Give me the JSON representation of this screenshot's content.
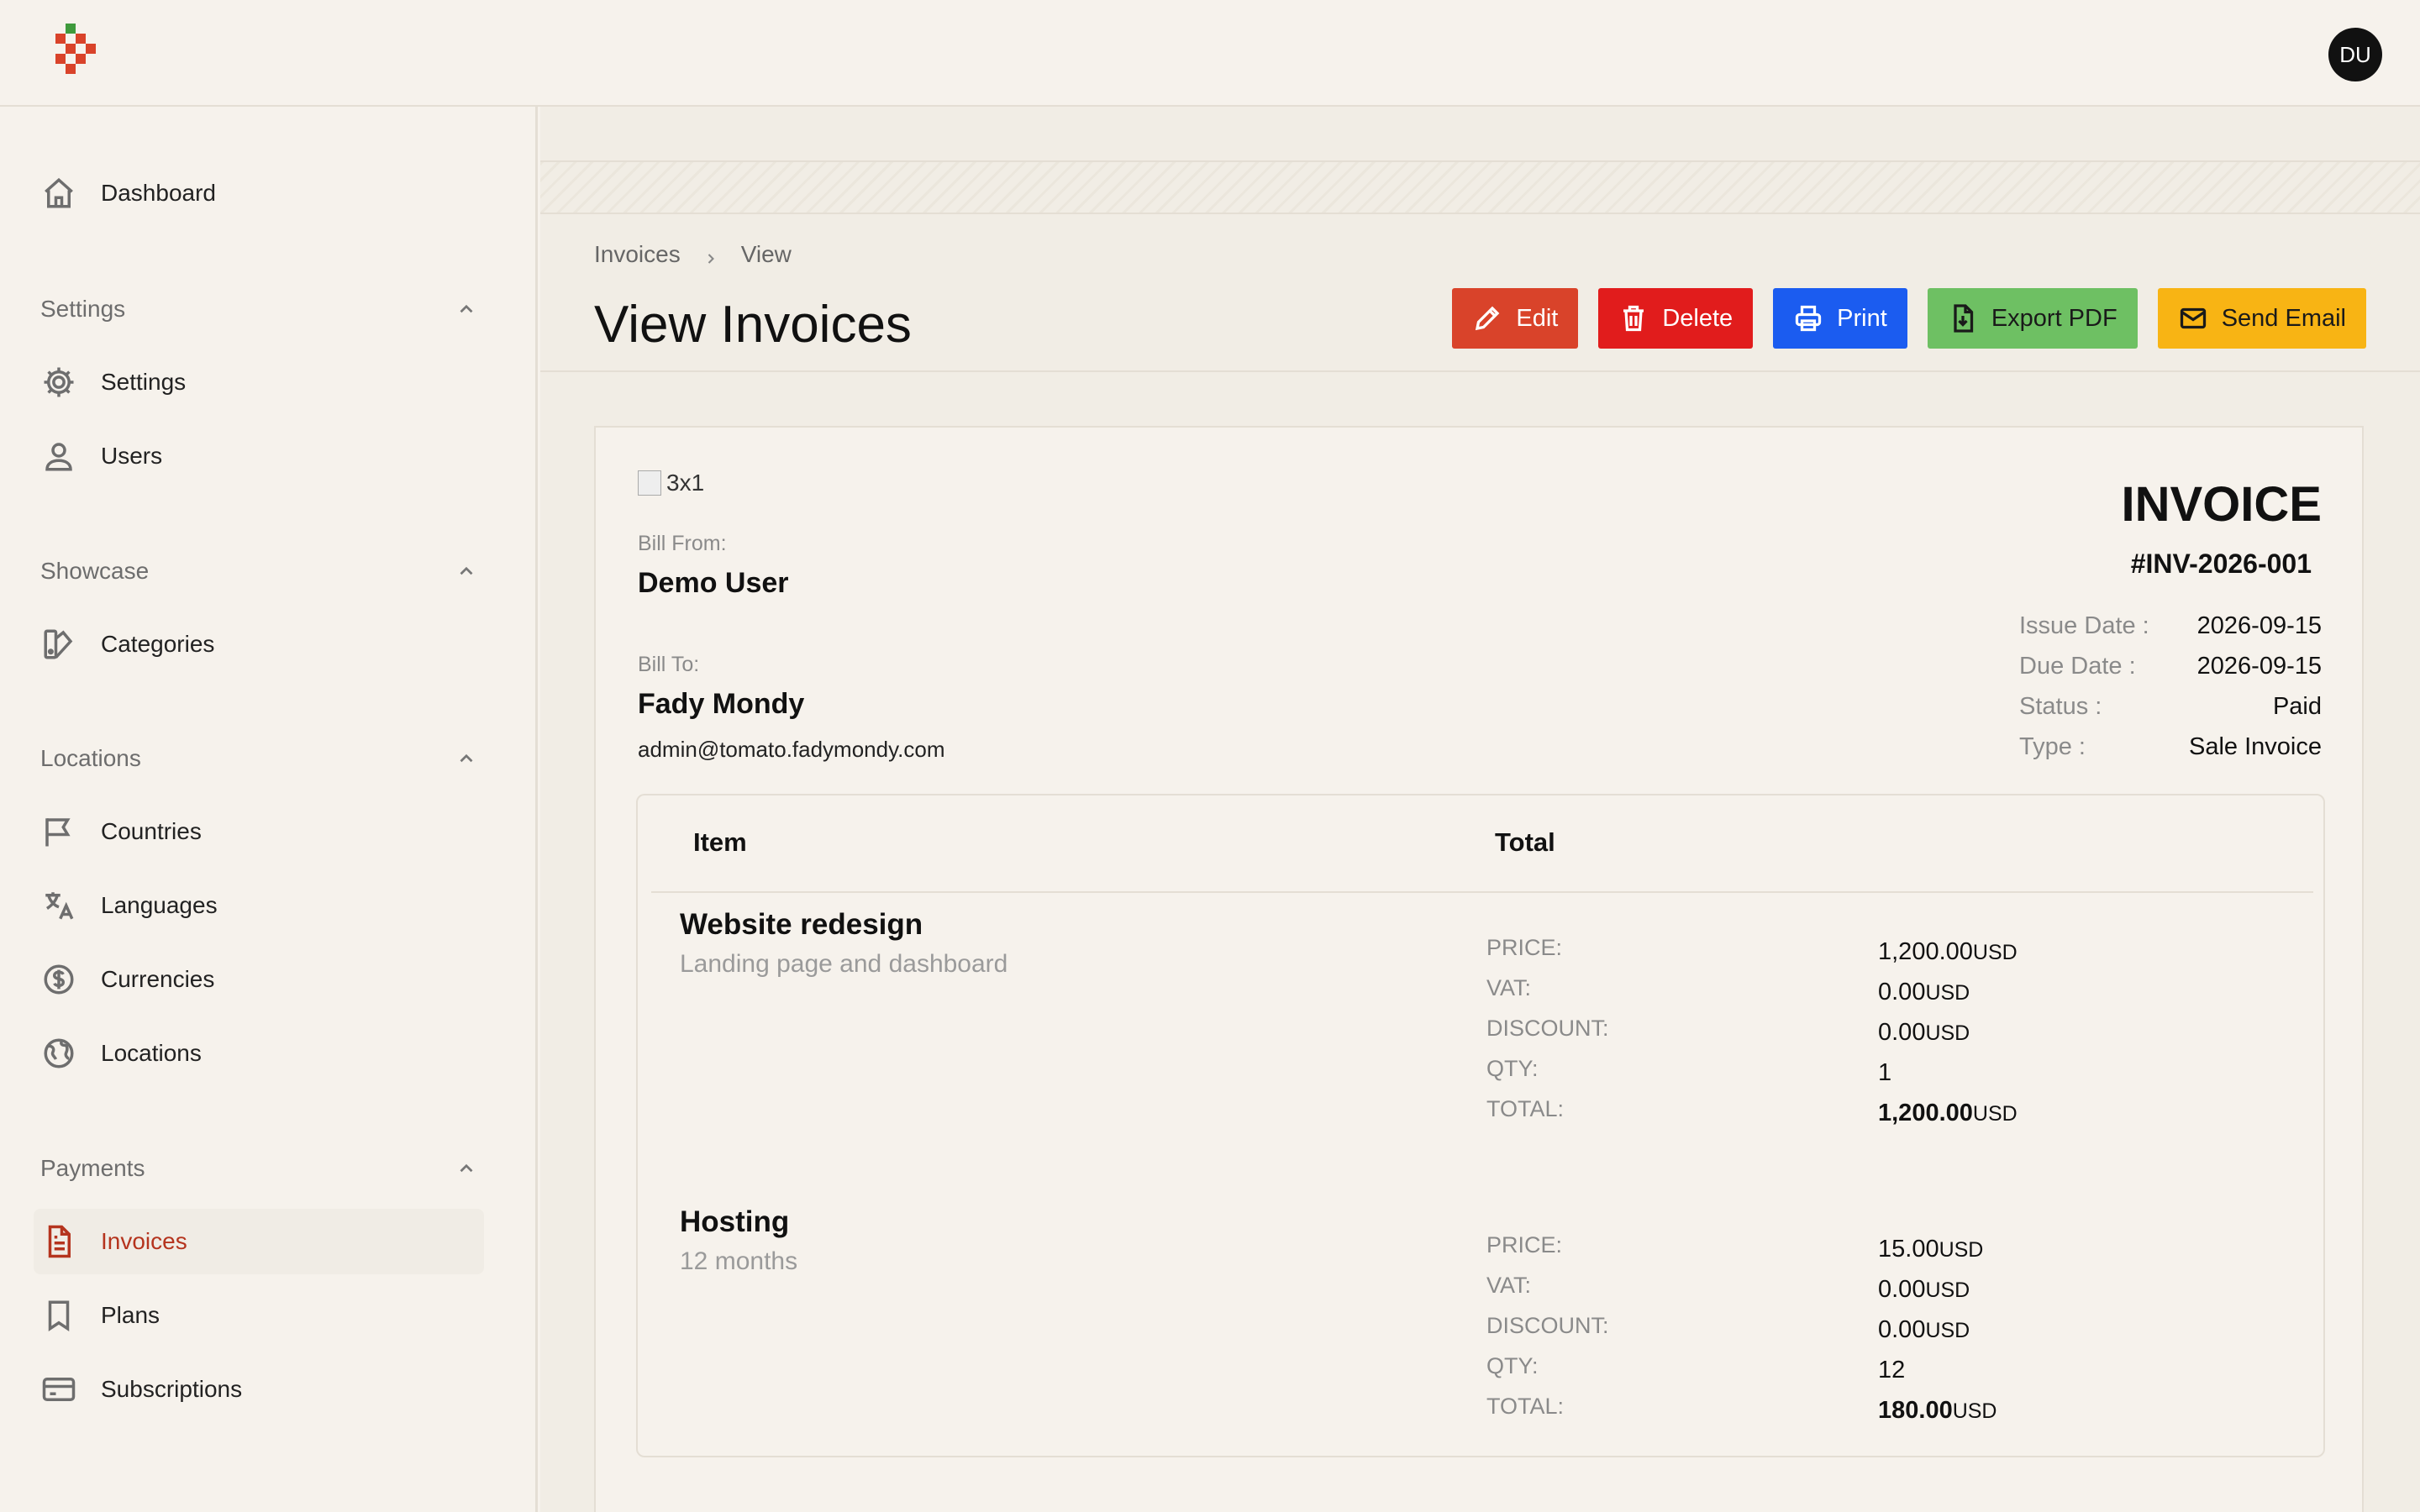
{
  "topbar": {
    "avatar_initials": "DU"
  },
  "sidebar": {
    "dashboard": "Dashboard",
    "groups": {
      "settings": "Settings",
      "showcase": "Showcase",
      "locations": "Locations",
      "payments": "Payments"
    },
    "items": {
      "settings": "Settings",
      "users": "Users",
      "categories": "Categories",
      "countries": "Countries",
      "languages": "Languages",
      "currencies": "Currencies",
      "locations": "Locations",
      "invoices": "Invoices",
      "plans": "Plans",
      "subscriptions": "Subscriptions"
    },
    "active": "invoices"
  },
  "header": {
    "breadcrumb": [
      "Invoices",
      "View"
    ],
    "title": "View Invoices",
    "actions": {
      "edit": "Edit",
      "delete": "Delete",
      "print": "Print",
      "export": "Export PDF",
      "email": "Send Email"
    },
    "colors": {
      "edit": "#d9432a",
      "delete": "#e11c1c",
      "print": "#1b5cf0",
      "export": "#6ec063",
      "email": "#f8b414"
    }
  },
  "invoice": {
    "logo_alt": "3x1",
    "bill_from_label": "Bill From:",
    "bill_from_name": "Demo User",
    "bill_to_label": "Bill To:",
    "bill_to_name": "Fady Mondy",
    "bill_to_email": "admin@tomato.fadymondy.com",
    "title": "INVOICE",
    "number": "#INV-2026-001",
    "meta": [
      {
        "label": "Issue Date :",
        "value": "2026-09-15"
      },
      {
        "label": "Due Date :",
        "value": "2026-09-15"
      },
      {
        "label": "Status :",
        "value": "Paid"
      },
      {
        "label": "Type :",
        "value": "Sale Invoice"
      }
    ],
    "table_headers": {
      "item": "Item",
      "total": "Total"
    },
    "items": [
      {
        "name": "Website redesign",
        "description": "Landing page and dashboard",
        "price_label": "PRICE:",
        "price": "1,200.00",
        "price_cur": "USD",
        "vat_label": "VAT:",
        "vat": "0.00",
        "vat_cur": "USD",
        "discount_label": "DISCOUNT:",
        "discount": "0.00",
        "discount_cur": "USD",
        "qty_label": "QTY:",
        "qty": "1",
        "total_label": "TOTAL:",
        "total": "1,200.00",
        "total_cur": "USD"
      },
      {
        "name": "Hosting",
        "description": "12 months",
        "price_label": "PRICE:",
        "price": "15.00",
        "price_cur": "USD",
        "vat_label": "VAT:",
        "vat": "0.00",
        "vat_cur": "USD",
        "discount_label": "DISCOUNT:",
        "discount": "0.00",
        "discount_cur": "USD",
        "qty_label": "QTY:",
        "qty": "12",
        "total_label": "TOTAL:",
        "total": "180.00",
        "total_cur": "USD"
      }
    ]
  }
}
